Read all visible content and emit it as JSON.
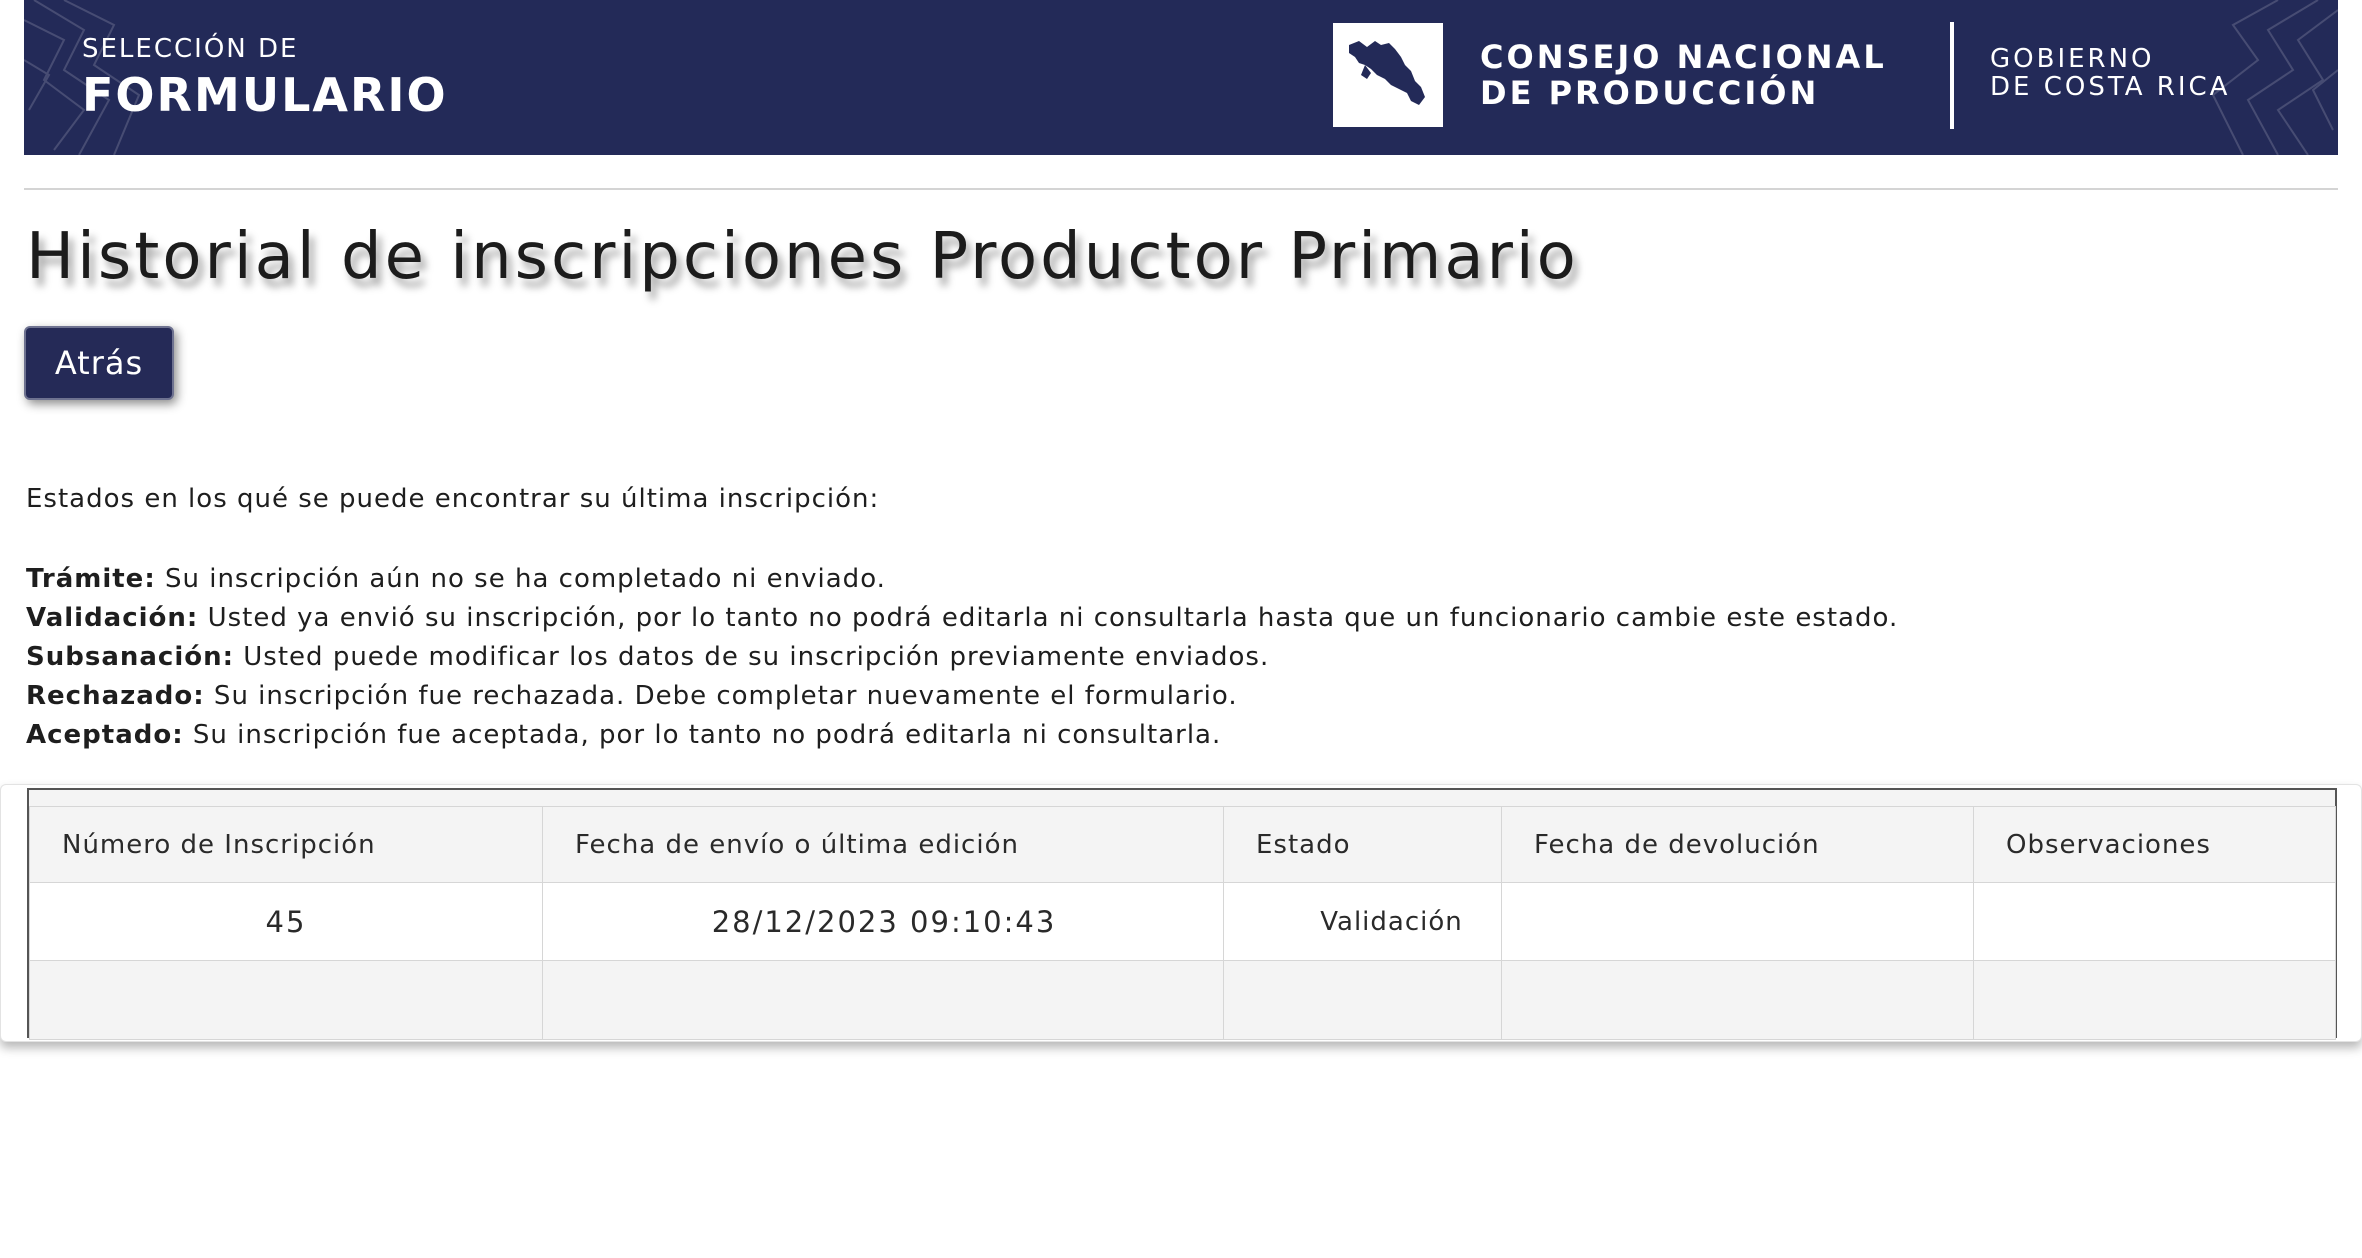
{
  "colors": {
    "banner_bg": "#232a58",
    "button_bg": "#252a57",
    "text": "#1e1e1e"
  },
  "banner": {
    "section_small": "SELECCIÓN DE",
    "section_big": "FORMULARIO",
    "org_line1": "CONSEJO NACIONAL",
    "org_line2": "DE PRODUCCIÓN",
    "gov_line1": "GOBIERNO",
    "gov_line2": "DE COSTA RICA",
    "logo_icon": "costa-rica-map-icon"
  },
  "page": {
    "title": "Historial de inscripciones Productor Primario",
    "back_label": "Atrás",
    "intro": "Estados en los qué se puede encontrar su última inscripción:"
  },
  "states": [
    {
      "term": "Trámite:",
      "desc": " Su inscripción aún no se ha completado ni enviado."
    },
    {
      "term": "Validación:",
      "desc": " Usted ya envió su inscripción, por lo tanto no podrá editarla ni consultarla hasta que un funcionario cambie este estado."
    },
    {
      "term": "Subsanación:",
      "desc": " Usted puede modificar los datos de su inscripción previamente enviados."
    },
    {
      "term": "Rechazado:",
      "desc": " Su inscripción fue rechazada. Debe completar nuevamente el formulario."
    },
    {
      "term": "Aceptado:",
      "desc": " Su inscripción fue aceptada, por lo tanto no podrá editarla ni consultarla."
    }
  ],
  "table": {
    "headers": [
      "Número de Inscripción",
      "Fecha de envío o última edición",
      "Estado",
      "Fecha de devolución",
      "Observaciones"
    ],
    "rows": [
      [
        "45",
        "28/12/2023 09:10:43",
        "Validación",
        "",
        ""
      ]
    ]
  }
}
